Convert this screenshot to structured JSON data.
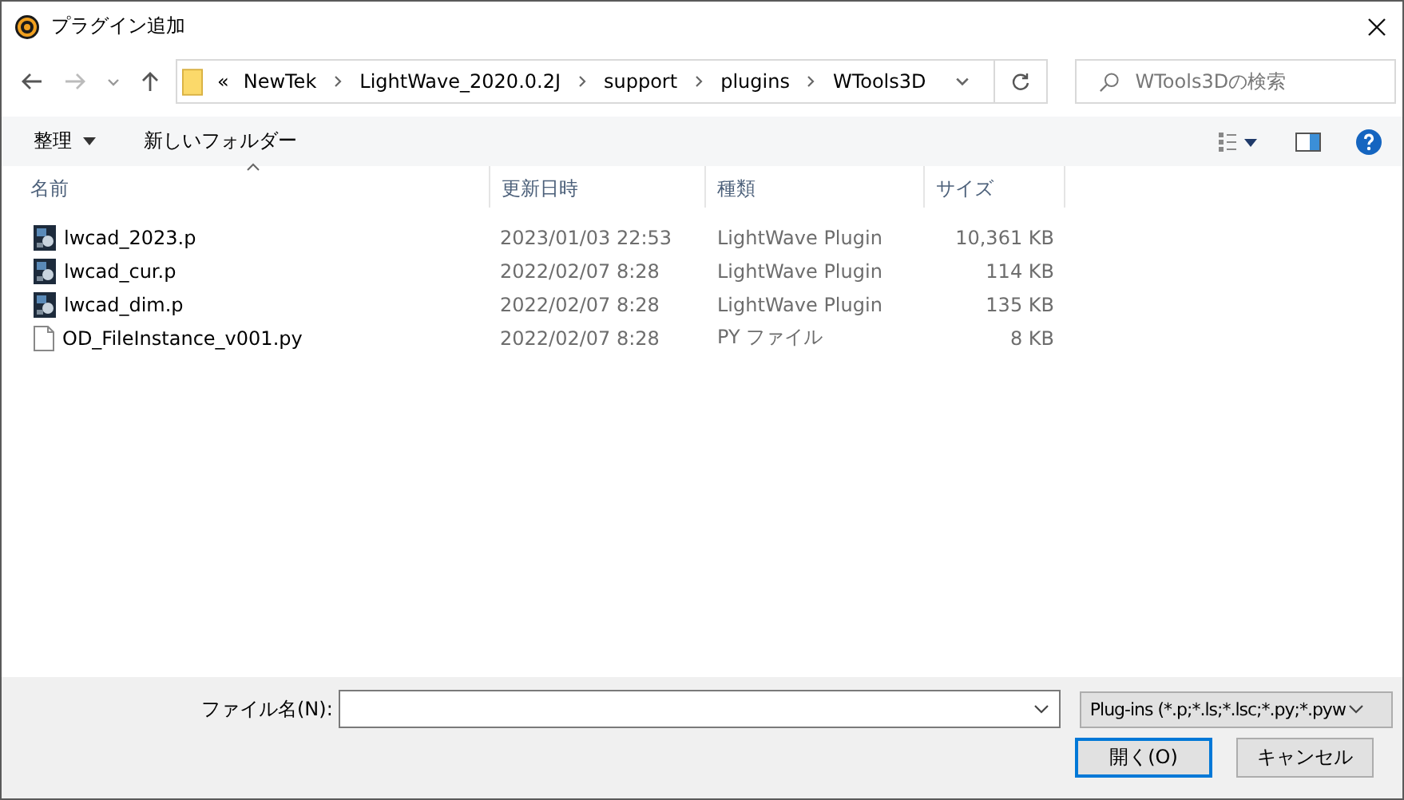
{
  "window": {
    "title": "プラグイン追加"
  },
  "breadcrumb": {
    "overflow": "«",
    "segments": [
      "NewTek",
      "LightWave_2020.0.2J",
      "support",
      "plugins",
      "WTools3D"
    ]
  },
  "search": {
    "placeholder": "WTools3Dの検索"
  },
  "toolbar": {
    "organize": "整理",
    "new_folder": "新しいフォルダー"
  },
  "columns": [
    "名前",
    "更新日時",
    "種類",
    "サイズ"
  ],
  "files": [
    {
      "kind": "plugin",
      "name": "lwcad_2023.p",
      "date": "2023/01/03 22:53",
      "type": "LightWave Plugin",
      "size": "10,361 KB"
    },
    {
      "kind": "plugin",
      "name": "lwcad_cur.p",
      "date": "2022/02/07 8:28",
      "type": "LightWave Plugin",
      "size": "114 KB"
    },
    {
      "kind": "plugin",
      "name": "lwcad_dim.p",
      "date": "2022/02/07 8:28",
      "type": "LightWave Plugin",
      "size": "135 KB"
    },
    {
      "kind": "document",
      "name": "OD_FileInstance_v001.py",
      "date": "2022/02/07 8:28",
      "type": "PY ファイル",
      "size": "8 KB"
    }
  ],
  "footer": {
    "filename_label": "ファイル名(N):",
    "filter": "Plug-ins (*.p;*.ls;*.lsc;*.py;*.pyw",
    "open": "開く(O)",
    "cancel": "キャンセル"
  }
}
